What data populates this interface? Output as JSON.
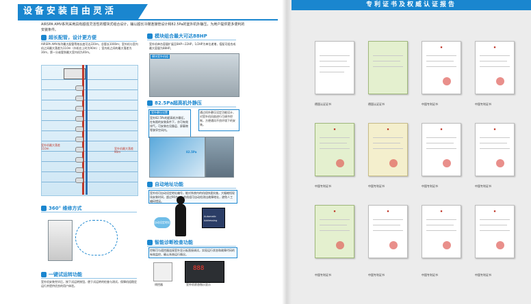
{
  "left": {
    "title": "设备安装自由灵活",
    "intro": "AIRSPA  AMV系列采用具有超强灵活性的模块式组合设计，辅以超长冷媒连接管设计和82.5Pa的室外机外静压，为用户提供更多便利的安装条件。",
    "sec1": {
      "title": "超长配管，设计更方便",
      "text": "AIRSPA AMV系列最大配管等效长度可达220m，总管长1000m；室外机与室内机之间最大落差为110m（外机在上时为90m）；室内机之间的最大落差为30m，第一分歧管到最大室内机为40m。"
    },
    "building": {
      "left_label": "室外机最大落差110m",
      "right_label": "室外机最大落差90m"
    },
    "sec2": {
      "title": "模块组合最大可达88HP",
      "text": "室外机单台容量扩展至8HP～22HP，1/2HP为单位递增，搭配可组合成最大容量为88HP。",
      "tag": "模块室外机组"
    },
    "sec3": {
      "title": "82.5Pa超高机外静压",
      "tag": "室外静压设置",
      "text_left": "室外82.5Pa的超高机外静压，在有限的安装条件下，亦可有效排气，可安装在设备层、屏蔽物等狭窄空间内。",
      "text_right": "通过机外静压设定功能设计，对室外机风扇进行可调节控制，方便通风不良环境下的安装。",
      "pressure_label": "82.5Pa"
    },
    "sec4": {
      "title": "360° 维修方式"
    },
    "sec5": {
      "title": "自动地址功能",
      "text": "室外机可自动设定地址编号，能对系统内的机组快速实施，大幅缩短现场安装时间，超过90台以上的机组可自动检测出故障地址，避免人工编码错误。",
      "bubble": "自动设定地址",
      "device_label": "Automatic Addressing"
    },
    "sec6": {
      "title": "智能诊断检查功能",
      "text": "控制可与遥控器连接室外显示板直接调试，实现运行状态和故障代码的有效监控，确认系统运行情况。",
      "display": "888",
      "remote_label": "线控器",
      "panel_label": "室外机状态指示显示"
    },
    "sec7": {
      "title": "一键试运转功能",
      "text": "室外机安装完毕后，按下试运转按钮，便于试运转的检查与测试，保障机组稳定运行并提供优良的用户体验。"
    }
  },
  "right": {
    "title": "专利证书及权威认证报告",
    "certs": [
      {
        "caption": "德国认证证书"
      },
      {
        "caption": "德国认证证书"
      },
      {
        "caption": "中国专利证书"
      },
      {
        "caption": "中国专利证书"
      },
      {
        "caption": "中国专利证书"
      },
      {
        "caption": "中国专利证书"
      },
      {
        "caption": "中国专利证书"
      },
      {
        "caption": "中国专利证书"
      },
      {
        "caption": "中国专利证书"
      },
      {
        "caption": "中国专利证书"
      },
      {
        "caption": "中国专利证书"
      },
      {
        "caption": "中国专利证书"
      }
    ]
  }
}
